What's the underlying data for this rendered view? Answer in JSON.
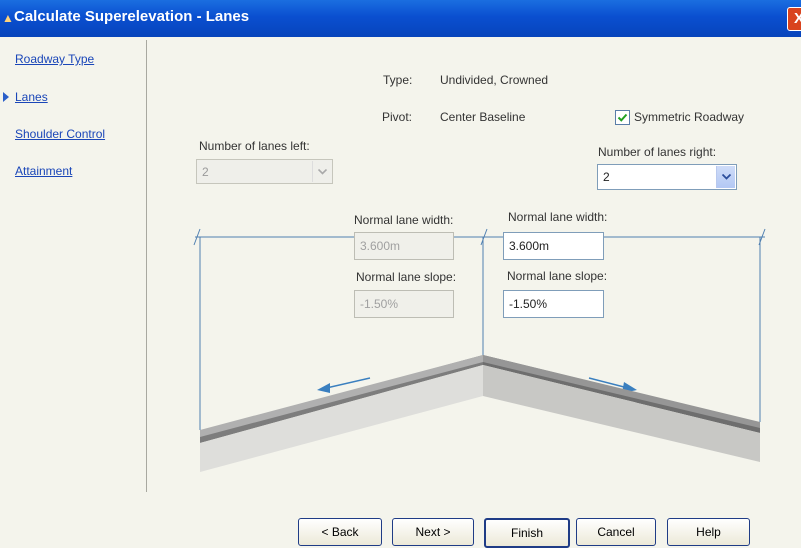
{
  "window": {
    "title": "Calculate Superelevation - Lanes",
    "close_glyph": "X"
  },
  "nav": {
    "items": [
      {
        "label": "Roadway Type"
      },
      {
        "label": "Lanes",
        "active": true
      },
      {
        "label": "Shoulder Control"
      },
      {
        "label": "Attainment"
      }
    ]
  },
  "info": {
    "type_label": "Type:",
    "type_value": "Undivided, Crowned",
    "pivot_label": "Pivot:",
    "pivot_value": "Center Baseline"
  },
  "symmetric": {
    "label": "Symmetric Roadway",
    "checked": true
  },
  "left": {
    "lanes_label": "Number of lanes left:",
    "lanes_value": "2",
    "width_label": "Normal lane width:",
    "width_value": "3.600m",
    "slope_label": "Normal lane slope:",
    "slope_value": "-1.50%"
  },
  "right": {
    "lanes_label": "Number of lanes right:",
    "lanes_value": "2",
    "width_label": "Normal lane width:",
    "width_value": "3.600m",
    "slope_label": "Normal lane slope:",
    "slope_value": "-1.50%"
  },
  "buttons": {
    "back": "< Back",
    "next": "Next >",
    "finish": "Finish",
    "cancel": "Cancel",
    "help": "Help"
  },
  "colors": {
    "title_bar": "#0a4fd0",
    "link": "#1a46b8",
    "dimension_line": "#4f7fb0",
    "slope_arrow": "#3a7fbf"
  }
}
